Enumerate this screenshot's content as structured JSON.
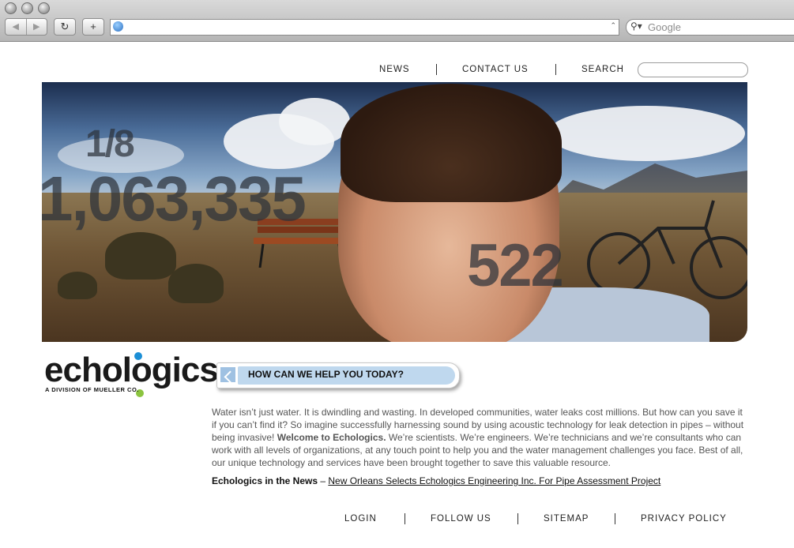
{
  "browser": {
    "back_label": "◀",
    "forward_label": "▶",
    "reload_label": "↻",
    "newtab_label": "+",
    "url": "",
    "search_placeholder": "Google"
  },
  "topnav": {
    "news": "NEWS",
    "contact": "CONTACT US",
    "search_label": "SEARCH"
  },
  "hero": {
    "stat1": "1/8",
    "stat2": "1,063,335",
    "stat3": "522"
  },
  "logo": {
    "name": "echologics",
    "subtitle": "A DIVISION OF MUELLER CO.",
    "colors": {
      "blue": "#1c8fd6",
      "green": "#8bc43f"
    }
  },
  "help": {
    "title": "HOW CAN WE HELP YOU TODAY?"
  },
  "intro": {
    "text_before": "Water isn’t just water. It is dwindling and wasting. In developed communities, water leaks cost millions. But how can you save it if you can’t find it? So imagine successfully harnessing sound by using acoustic technology for leak detection in pipes – without being invasive! ",
    "bold": "Welcome to Echologics.",
    "text_after": " We’re scientists. We’re engineers. We’re technicians and we’re consultants who can work with all levels of organizations, at any touch point to help you and the water management challenges you face. Best of all, our unique technology and services have been brought together to save this valuable resource."
  },
  "news": {
    "label": "Echologics in the News",
    "dash": " – ",
    "link": "New Orleans Selects Echologics Engineering Inc. For Pipe Assessment Project"
  },
  "footer": {
    "login": "LOGIN",
    "follow": "FOLLOW US",
    "sitemap": "SITEMAP",
    "privacy": "PRIVACY POLICY"
  }
}
